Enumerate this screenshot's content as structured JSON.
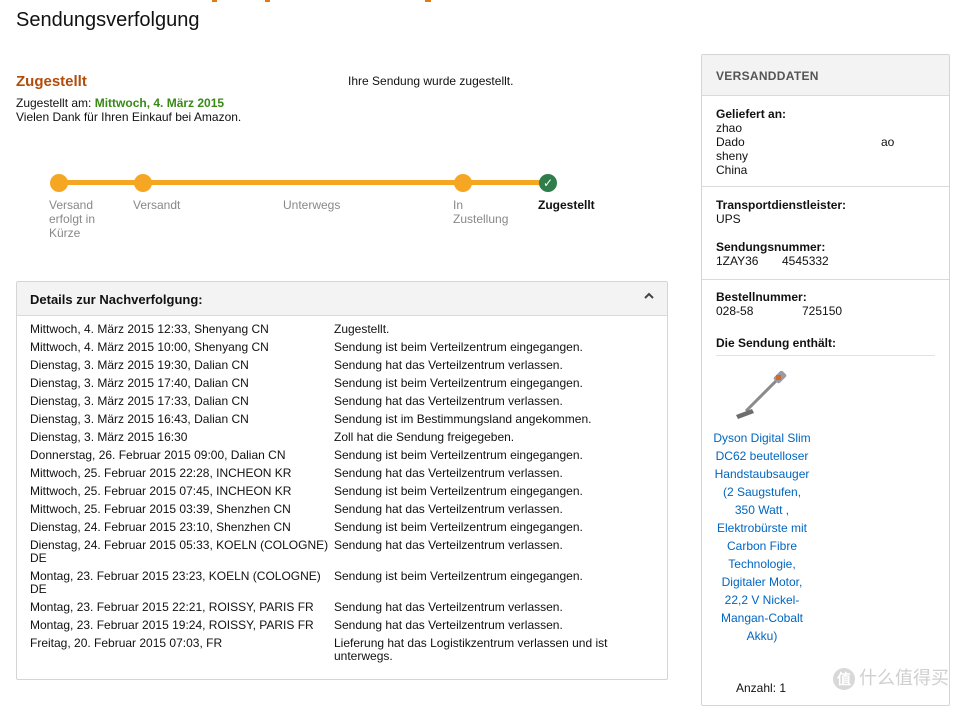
{
  "page": {
    "title": "Sendungsverfolgung"
  },
  "status": {
    "heading": "Zugestellt",
    "message": "Ihre Sendung wurde zugestellt.",
    "delivered_prefix": "Zugestellt am: ",
    "delivered_date": "Mittwoch, 4. März 2015",
    "thanks": "Vielen Dank für Ihren Einkauf bei Amazon."
  },
  "tracker": {
    "steps": [
      {
        "label": "Versand erfolgt in Kürze",
        "state": "complete"
      },
      {
        "label": "Versandt",
        "state": "complete"
      },
      {
        "label": "Unterwegs",
        "state": "none"
      },
      {
        "label": "In Zustellung",
        "state": "complete"
      },
      {
        "label": "Zugestellt",
        "state": "current"
      }
    ],
    "check_glyph": "✓"
  },
  "details": {
    "title": "Details zur Nachverfolgung:",
    "events": [
      {
        "when": "Mittwoch, 4. März 2015 12:33, Shenyang CN",
        "what": "Zugestellt."
      },
      {
        "when": "Mittwoch, 4. März 2015 10:00, Shenyang CN",
        "what": "Sendung ist beim Verteilzentrum eingegangen."
      },
      {
        "when": "Dienstag, 3. März 2015 19:30, Dalian CN",
        "what": "Sendung hat das Verteilzentrum verlassen."
      },
      {
        "when": "Dienstag, 3. März 2015 17:40, Dalian CN",
        "what": "Sendung ist beim Verteilzentrum eingegangen."
      },
      {
        "when": "Dienstag, 3. März 2015 17:33, Dalian CN",
        "what": "Sendung hat das Verteilzentrum verlassen."
      },
      {
        "when": "Dienstag, 3. März 2015 16:43, Dalian CN",
        "what": "Sendung ist im Bestimmungsland angekommen."
      },
      {
        "when": "Dienstag, 3. März 2015 16:30",
        "what": "Zoll hat die Sendung freigegeben."
      },
      {
        "when": "Donnerstag, 26. Februar 2015 09:00, Dalian CN",
        "what": "Sendung ist beim Verteilzentrum eingegangen."
      },
      {
        "when": "Mittwoch, 25. Februar 2015 22:28, INCHEON KR",
        "what": "Sendung hat das Verteilzentrum verlassen."
      },
      {
        "when": "Mittwoch, 25. Februar 2015 07:45, INCHEON KR",
        "what": "Sendung ist beim Verteilzentrum eingegangen."
      },
      {
        "when": "Mittwoch, 25. Februar 2015 03:39, Shenzhen CN",
        "what": "Sendung hat das Verteilzentrum verlassen."
      },
      {
        "when": "Dienstag, 24. Februar 2015 23:10, Shenzhen CN",
        "what": "Sendung ist beim Verteilzentrum eingegangen."
      },
      {
        "when": "Dienstag, 24. Februar 2015 05:33, KOELN (COLOGNE) DE",
        "what": "Sendung hat das Verteilzentrum verlassen."
      },
      {
        "when": "Montag, 23. Februar 2015 23:23, KOELN (COLOGNE) DE",
        "what": "Sendung ist beim Verteilzentrum eingegangen."
      },
      {
        "when": "Montag, 23. Februar 2015 22:21, ROISSY, PARIS FR",
        "what": "Sendung hat das Verteilzentrum verlassen."
      },
      {
        "when": "Montag, 23. Februar 2015 19:24, ROISSY, PARIS FR",
        "what": "Sendung hat das Verteilzentrum verlassen."
      },
      {
        "when": "Freitag, 20. Februar 2015 07:03, FR",
        "what": "Lieferung hat das Logistikzentrum verlassen und ist unterwegs."
      }
    ]
  },
  "sidebar": {
    "title": "VERSANDDATEN",
    "delivered_to_label": "Geliefert an:",
    "address": [
      "zhao ",
      "Dado",
      "sheny",
      "China"
    ],
    "address_tail": "ao",
    "carrier_label": "Transportdienstleister:",
    "carrier": "UPS",
    "tracking_label": "Sendungsnummer:",
    "tracking_start": "1ZAY36",
    "tracking_end": "4545332",
    "order_label": "Bestellnummer:",
    "order_start": "028-58",
    "order_end": "725150",
    "contents_label": "Die Sendung enthält:",
    "product_name": "Dyson Digital Slim DC62 beutelloser Handstaubsauger (2 Saugstufen, 350 Watt , Elektrobürste mit Carbon Fibre Technologie, Digitaler Motor, 22,2 V Nickel-Mangan-Cobalt Akku)",
    "quantity": "Anzahl: 1"
  },
  "watermark": {
    "text": "什么值得买",
    "icon_glyph": "值"
  }
}
